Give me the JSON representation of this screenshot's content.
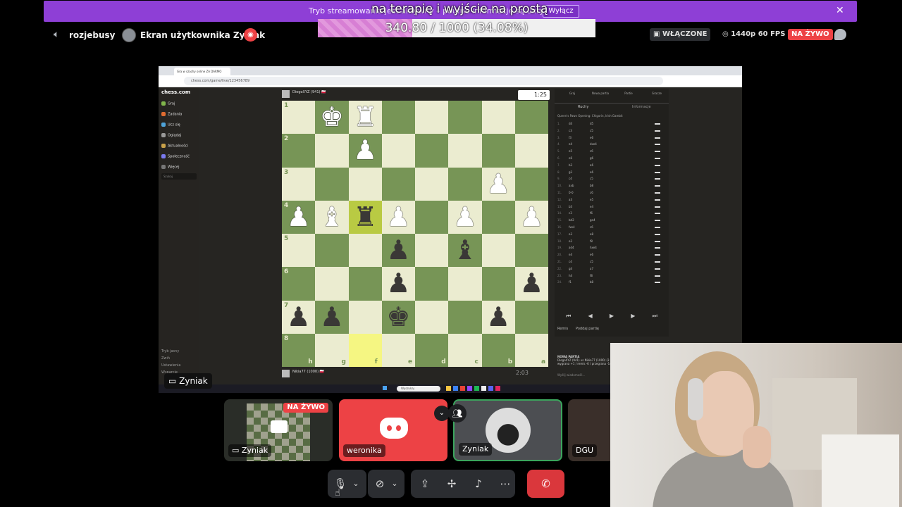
{
  "banner": {
    "text": "Tryb streamowania jest aktywny – poufne informacje są ukryte.",
    "disable_label": "Wyłącz",
    "close_icon": "close-icon",
    "color": "#8e3fd6"
  },
  "overlay": {
    "title": "na terapię i wyjście na prostą",
    "progress_text": "340.80 / 1000 (34.08%)",
    "progress_current": 340.8,
    "progress_goal": 1000,
    "progress_fraction": 0.3408
  },
  "header": {
    "channel_name": "rozjebusy",
    "stream_title": "Ekran użytkownika Zyniak",
    "enabled_label": "WŁĄCZONE",
    "quality_label": "1440p 60 FPS",
    "live_label": "NA ŻYWO",
    "live_color": "#ed4245"
  },
  "chess": {
    "tab_title": "Gra w szachy online ZA DARMO",
    "url": "chess.com/game/live/123456789",
    "logo": "chess.com",
    "nav": [
      {
        "label": "Graj",
        "color": "#81b64c"
      },
      {
        "label": "Zadania",
        "color": "#e06c31"
      },
      {
        "label": "Ucz się",
        "color": "#4fa3d9"
      },
      {
        "label": "Oglądaj",
        "color": "#999999"
      },
      {
        "label": "Aktualności",
        "color": "#c8a14a"
      },
      {
        "label": "Społeczność",
        "color": "#7a7af0"
      },
      {
        "label": "Więcej",
        "color": "#777777"
      }
    ],
    "search_placeholder": "Szukaj",
    "bottom_nav": [
      "Tryb jasny",
      "Zwiń",
      "Ustawienia",
      "Wsparcie"
    ],
    "top_player": "DiegoXYZ (941) 🇵🇱",
    "top_clock": "1:25",
    "bottom_player": "Nikia77 (1000) 🇵🇱",
    "bottom_clock": "2:03",
    "ranks": [
      "1",
      "2",
      "3",
      "4",
      "5",
      "6",
      "7",
      "8"
    ],
    "files": [
      "h",
      "g",
      "f",
      "e",
      "d",
      "c",
      "b",
      "a"
    ],
    "board": [
      [
        "",
        "wk",
        "wr",
        "",
        "",
        "",
        "",
        ""
      ],
      [
        "",
        "",
        "wp",
        "",
        "",
        "",
        "",
        ""
      ],
      [
        "",
        "",
        "",
        "",
        "",
        "",
        "wp",
        ""
      ],
      [
        "wp",
        "wb",
        "br",
        "wp",
        "",
        "wp",
        "",
        "wp"
      ],
      [
        "",
        "",
        "",
        "bp",
        "",
        "bb",
        "",
        ""
      ],
      [
        "",
        "",
        "",
        "bp",
        "",
        "",
        "",
        "bp"
      ],
      [
        "bp",
        "bp",
        "",
        "bk",
        "",
        "",
        "bp",
        ""
      ],
      [
        "",
        "",
        "",
        "",
        "",
        "",
        "",
        ""
      ]
    ],
    "highlight": [
      [
        3,
        2
      ],
      [
        7,
        2
      ]
    ],
    "panel_tabs": [
      "Graj",
      "Nowa partia",
      "Partie",
      "Gracze"
    ],
    "move_tabs": [
      "Ruchy",
      "Informacje"
    ],
    "opening": "Queen's Pawn Opening: Chigorin, Irish Gambit",
    "moves": [
      [
        "d4",
        "d5"
      ],
      [
        "c3",
        "c5"
      ],
      [
        "f3",
        "e6"
      ],
      [
        "e4",
        "dxe4"
      ],
      [
        "e5",
        "c6"
      ],
      [
        "e6",
        "g6"
      ],
      [
        "b3",
        "a6"
      ],
      [
        "g3",
        "e6"
      ],
      [
        "c4",
        "c5"
      ],
      [
        "axb",
        "b8"
      ],
      [
        "0-0",
        "c6"
      ],
      [
        "a3",
        "e5"
      ],
      [
        "b3",
        "e4"
      ],
      [
        "c3",
        "f6"
      ],
      [
        "bd2",
        "ge4"
      ],
      [
        "fxe4",
        "c6"
      ],
      [
        "e3",
        "e8"
      ],
      [
        "e2",
        "f8"
      ],
      [
        "ad4",
        "hxe4"
      ],
      [
        "e4",
        "e6"
      ],
      [
        "c4",
        "c5"
      ],
      [
        "g4",
        "a7"
      ],
      [
        "h4",
        "f8"
      ],
      [
        "f1",
        "b8"
      ]
    ],
    "panel_actions": [
      "Remis",
      "Poddaj partię"
    ],
    "chat_heading": "NOWA PARTIA",
    "chat_line1": "DiegoXYZ (941) vs Nikia77 (1000) (3 min)",
    "chat_line2": "wygrana +1 / remis -6 / przegrana -14",
    "chat_placeholder": "Wyślij wiadomość…",
    "taskbar_search": "Wyszukaj"
  },
  "user_tag": "Zyniak",
  "tiles": [
    {
      "label": "Zyniak",
      "live": "NA ŻYWO"
    },
    {
      "label": "weronika",
      "color": "#ed4245"
    },
    {
      "label": "Zyniak",
      "border": "#3ba55d"
    },
    {
      "label": "DGU"
    }
  ],
  "controls": [
    "microphone-icon",
    "chevron-down-icon",
    "camera-off-icon",
    "chevron-down-icon",
    "screen-share-icon",
    "activities-icon",
    "soundboard-icon",
    "more-icon",
    "leave-call-icon"
  ]
}
